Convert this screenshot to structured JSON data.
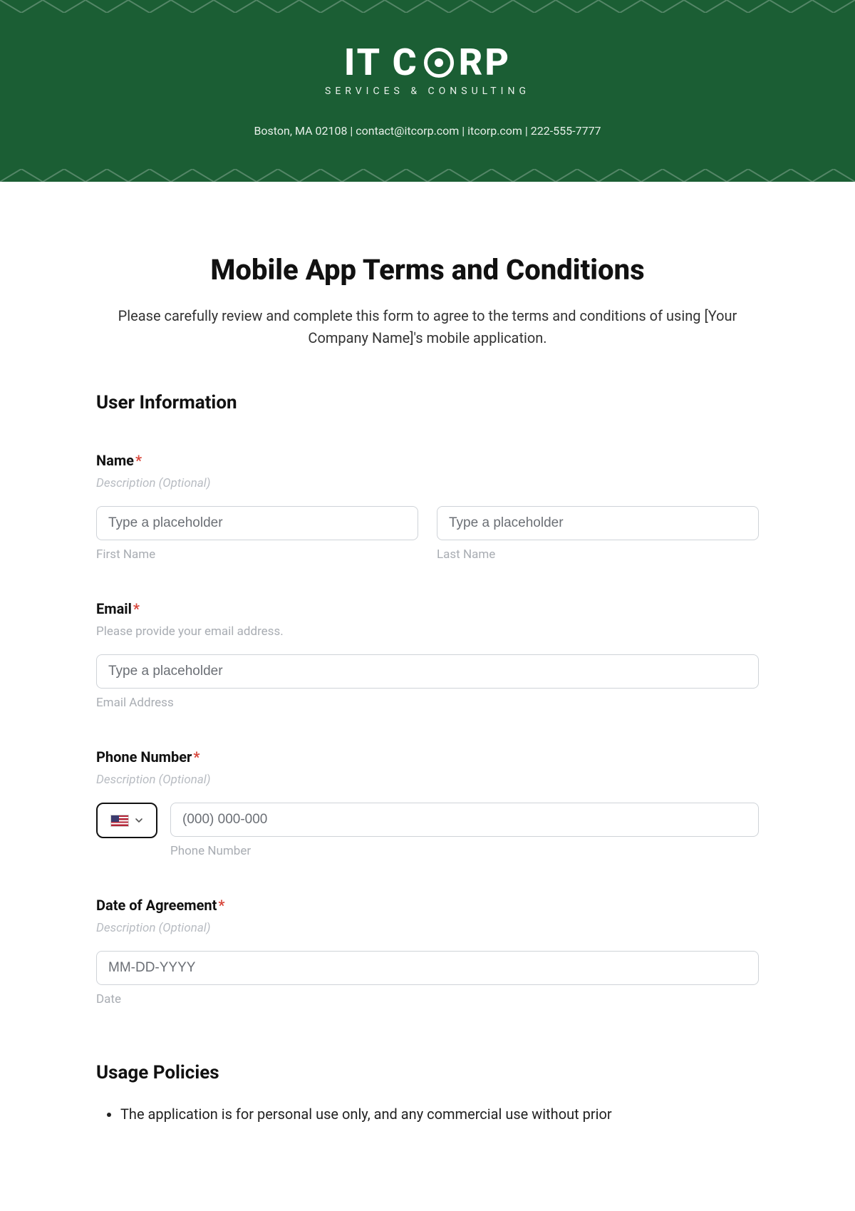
{
  "header": {
    "logo_it": "IT C",
    "logo_rp": "RP",
    "tagline": "SERVICES & CONSULTING",
    "contact": "Boston, MA 02108 | contact@itcorp.com | itcorp.com | 222-555-7777"
  },
  "page": {
    "title": "Mobile App Terms and Conditions",
    "intro": "Please carefully review and complete this form to agree to the terms and conditions of using [Your Company Name]'s mobile application."
  },
  "section_user_info": "User Information",
  "name": {
    "label": "Name",
    "desc": "Description (Optional)",
    "first_ph": "Type a placeholder",
    "first_sub": "First Name",
    "last_ph": "Type a placeholder",
    "last_sub": "Last Name"
  },
  "email": {
    "label": "Email",
    "desc": "Please provide your email address.",
    "ph": "Type a placeholder",
    "sub": "Email Address"
  },
  "phone": {
    "label": "Phone Number",
    "desc": "Description (Optional)",
    "ph": "(000) 000-000",
    "sub": "Phone Number"
  },
  "date": {
    "label": "Date of Agreement",
    "desc": "Description (Optional)",
    "ph": "MM-DD-YYYY",
    "sub": "Date"
  },
  "section_usage": "Usage Policies",
  "usage_item_1": "The application is for personal use only, and any commercial use without prior"
}
